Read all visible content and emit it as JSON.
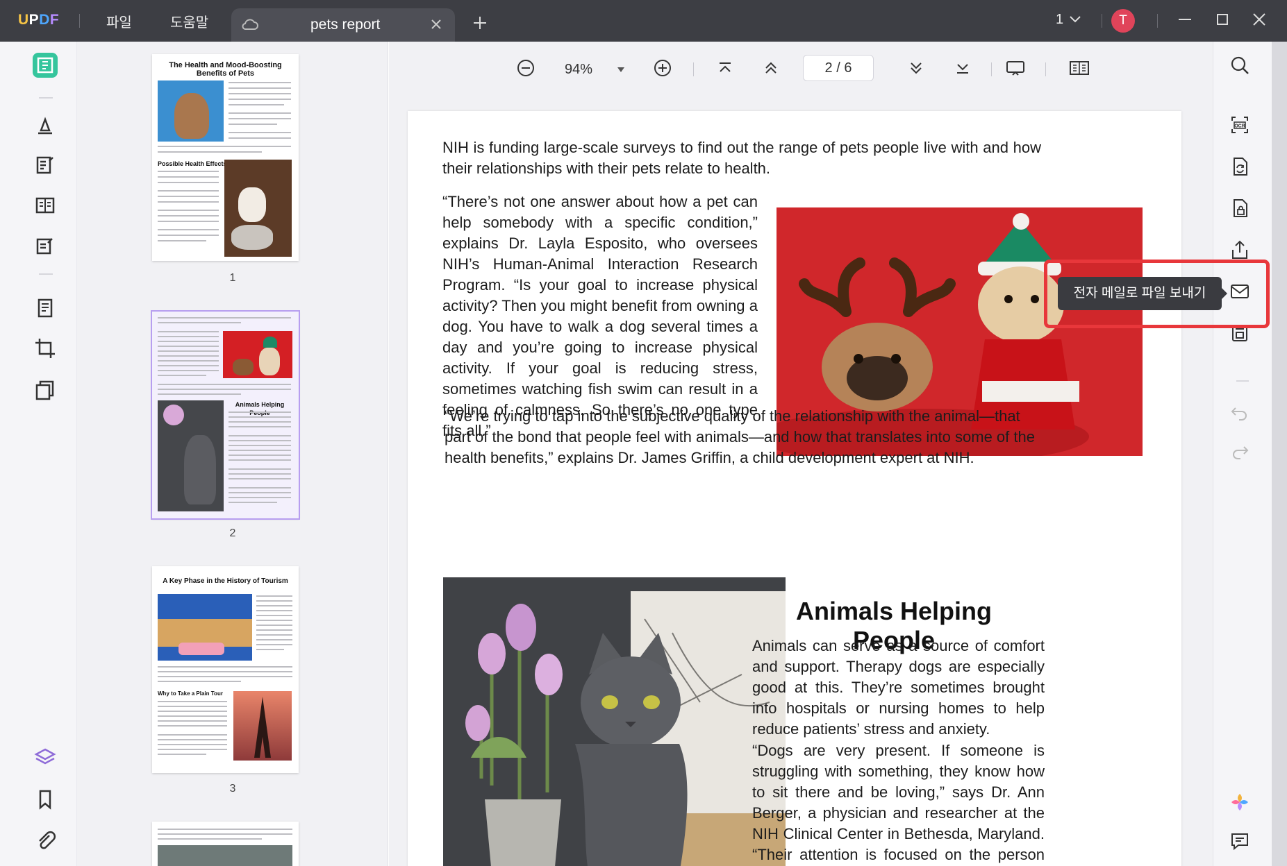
{
  "app": {
    "logo": "UPDF",
    "menu": [
      "파일",
      "도움말"
    ],
    "tab_title": "pets report",
    "avatar_letter": "T",
    "page_selector": "1"
  },
  "toolbar": {
    "zoom": "94%",
    "page_current": "2",
    "page_total": "6",
    "page_display": "2 / 6"
  },
  "tooltip": {
    "text": "전자 메일로 파일 보내기"
  },
  "thumbnails": [
    {
      "title": "The Health and Mood-Boosting Benefits of Pets",
      "sub": "Possible Health Effects",
      "number": "1"
    },
    {
      "title": "Animals Helping People",
      "number": "2"
    },
    {
      "title": "A Key Phase in the History of Tourism",
      "sub": "Why to Take a Plain Tour",
      "number": "3"
    }
  ],
  "document": {
    "para1": "NIH is funding large-scale surveys to find out the range of pets people live with and how their relationships with their pets relate to health.",
    "para2": "“There’s not one answer about how a pet can help somebody with a specific condition,” explains Dr. Layla Esposito, who oversees NIH’s Human-Animal Interaction Research Program. “Is your goal to increase physical activity? Then you might benefit from owning a dog. You have to walk a dog several times a day and you’re going to increase physical activity. If your goal is reducing stress, sometimes watching fish swim can result in a feeling of calmness. So there’s no one type fits all.”",
    "para3": "“We’re trying to tap into the subjective quality of the relationship with the animal—that part of the bond that people feel with animals—and how that translates into some of the health benefits,” explains Dr. James Griffin, a child development expert at NIH.",
    "heading": "Animals Helping People",
    "para4": "Animals can serve as a source of comfort and support. Therapy dogs are especially good at this. They’re sometimes brought into hospitals or nursing homes to help reduce patients’ stress and anxiety.",
    "para5": "“Dogs are very present. If someone is struggling with something, they know how to sit there and be loving,” says Dr. Ann Berger, a physician and researcher at the NIH Clinical Center in Bethesda, Maryland. “Their attention is focused on the person all the time.”"
  },
  "colors": {
    "titlebar": "#3d3e44",
    "accent_green": "#35c59d",
    "highlight_red": "#e8373b",
    "avatar": "#e0445a"
  }
}
